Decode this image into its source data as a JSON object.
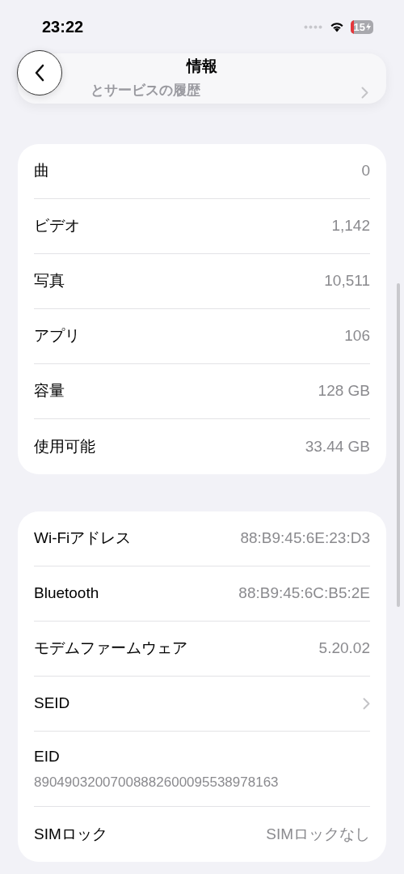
{
  "status_bar": {
    "time": "23:22",
    "battery": "15"
  },
  "header": {
    "title": "情報"
  },
  "behind_row": {
    "label": "とサービスの履歴"
  },
  "sections": [
    {
      "rows": [
        {
          "kind": "value",
          "label": "曲",
          "value": "0"
        },
        {
          "kind": "value",
          "label": "ビデオ",
          "value": "1,142"
        },
        {
          "kind": "value",
          "label": "写真",
          "value": "10,511"
        },
        {
          "kind": "value",
          "label": "アプリ",
          "value": "106"
        },
        {
          "kind": "value",
          "label": "容量",
          "value": "128 GB"
        },
        {
          "kind": "value",
          "label": "使用可能",
          "value": "33.44 GB"
        }
      ]
    },
    {
      "rows": [
        {
          "kind": "value",
          "label": "Wi-Fiアドレス",
          "value": "88:B9:45:6E:23:D3"
        },
        {
          "kind": "value",
          "label": "Bluetooth",
          "value": "88:B9:45:6C:B5:2E"
        },
        {
          "kind": "value",
          "label": "モデムファームウェア",
          "value": "5.20.02"
        },
        {
          "kind": "chevron",
          "label": "SEID"
        },
        {
          "kind": "stacked",
          "label": "EID",
          "value": "89049032007008882600095538978163"
        },
        {
          "kind": "value",
          "label": "SIMロック",
          "value": "SIMロックなし"
        }
      ]
    }
  ]
}
